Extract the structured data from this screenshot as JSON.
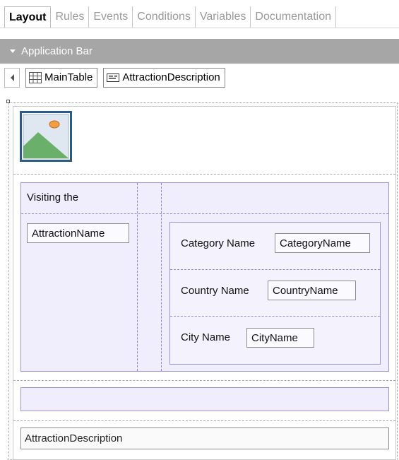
{
  "tabs": [
    {
      "label": "Layout",
      "active": true
    },
    {
      "label": "Rules",
      "active": false
    },
    {
      "label": "Events",
      "active": false
    },
    {
      "label": "Conditions",
      "active": false
    },
    {
      "label": "Variables",
      "active": false
    },
    {
      "label": "Documentation",
      "active": false
    }
  ],
  "app_bar": {
    "label": "Application Bar"
  },
  "breadcrumb": {
    "main_table": "MainTable",
    "attraction_description": "AttractionDescription"
  },
  "layout": {
    "visiting_label": "Visiting the",
    "attraction_name_field": "AttractionName",
    "category_label": "Category Name",
    "category_field": "CategoryName",
    "country_label": "Country Name",
    "country_field": "CountryName",
    "city_label": "City Name",
    "city_field": "CityName",
    "description_field": "AttractionDescription"
  },
  "colors": {
    "app_bar": "#a6a6a6",
    "table_fill": "#f0eefc",
    "table_border": "#9a94d8",
    "image_frame": "#2b5b8a",
    "image_green": "#6ab06a",
    "image_sun": "#f0a040"
  },
  "icons": [
    "grid-table-icon",
    "textblock-icon",
    "image-placeholder-icon",
    "collapse-caret-icon",
    "scroll-left-icon"
  ]
}
